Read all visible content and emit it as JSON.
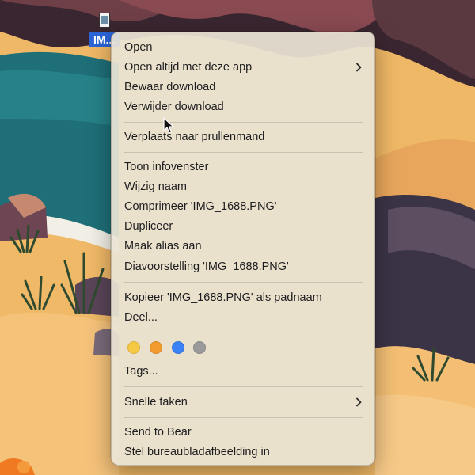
{
  "desktop": {
    "file_label": "IM...",
    "file_icon": "png-file-icon"
  },
  "context_menu": {
    "items": {
      "open": "Open",
      "open_with": "Open altijd met deze app",
      "keep_download": "Bewaar download",
      "delete_download": "Verwijder download",
      "move_to_trash": "Verplaats naar prullenmand",
      "get_info": "Toon infovenster",
      "rename": "Wijzig naam",
      "compress": "Comprimeer 'IMG_1688.PNG'",
      "duplicate": "Dupliceer",
      "make_alias": "Maak alias aan",
      "slideshow": "Diavoorstelling 'IMG_1688.PNG'",
      "copy_path": "Kopieer 'IMG_1688.PNG' als padnaam",
      "share": "Deel...",
      "tags": "Tags...",
      "quick_actions": "Snelle taken",
      "send_to_bear": "Send to Bear",
      "set_wallpaper": "Stel bureaubladafbeelding in"
    },
    "tag_colors": [
      {
        "name": "yellow",
        "hex": "#f6c944"
      },
      {
        "name": "orange",
        "hex": "#f39a2f"
      },
      {
        "name": "blue",
        "hex": "#3a82f6"
      },
      {
        "name": "gray",
        "hex": "#9a9a9a"
      }
    ]
  }
}
